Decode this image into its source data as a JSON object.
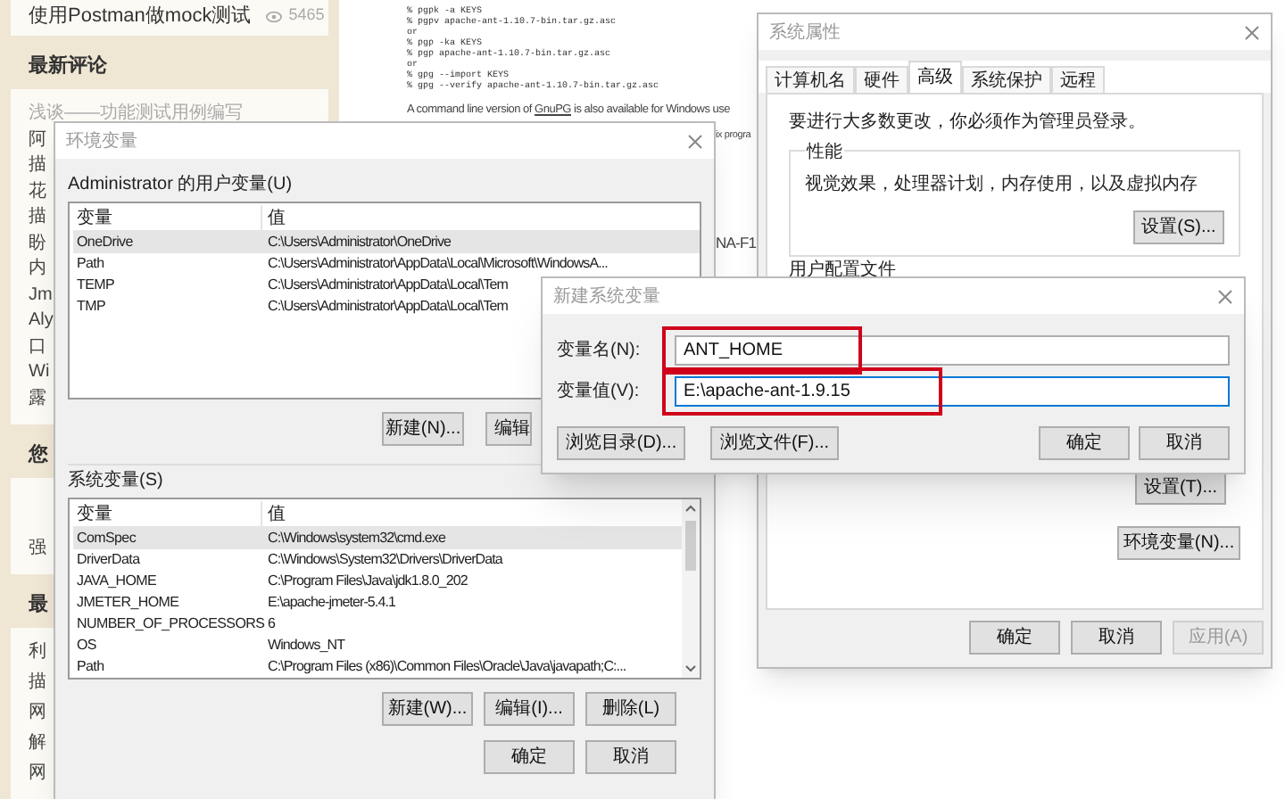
{
  "sidebar": {
    "popular_item": {
      "title": "使用Postman做mock测试",
      "views": "5465"
    },
    "sections": [
      {
        "heading": "最新评论",
        "lines": [
          "浅谈——功能测试用例编写",
          "阿",
          "描",
          "花",
          "描",
          "盼",
          "内",
          "Jm",
          "Aly",
          "口",
          "Wi",
          "露"
        ]
      },
      {
        "heading": "您",
        "lines": [
          "强"
        ]
      },
      {
        "heading": "最",
        "lines": [
          "利",
          "描",
          "网",
          "解",
          "网"
        ]
      }
    ]
  },
  "article": {
    "code_lines": [
      "% pgpk -a KEYS",
      "% pgpv apache-ant-1.10.7-bin.tar.gz.asc",
      "or",
      "% pgp -ka KEYS",
      "% pgp apache-ant-1.10.7-bin.tar.gz.asc",
      "or",
      "% gpg --import KEYS",
      "% gpg --verify apache-ant-1.10.7-bin.tar.gz.asc"
    ],
    "paragraph": {
      "before": "A command line version of ",
      "link": "GnuPG",
      "after": " is also available for Windows use"
    },
    "fragments": [
      "ix progra",
      "NA-F1"
    ]
  },
  "env_window": {
    "title": "环境变量",
    "user_section": {
      "label": "Administrator 的用户变量(U)",
      "columns": [
        "变量",
        "值"
      ],
      "rows": [
        {
          "name": "OneDrive",
          "value": "C:\\Users\\Administrator\\OneDrive",
          "selected": true
        },
        {
          "name": "Path",
          "value": "C:\\Users\\Administrator\\AppData\\Local\\Microsoft\\WindowsA...",
          "selected": false
        },
        {
          "name": "TEMP",
          "value": "C:\\Users\\Administrator\\AppData\\Local\\Tem",
          "selected": false
        },
        {
          "name": "TMP",
          "value": "C:\\Users\\Administrator\\AppData\\Local\\Tem",
          "selected": false
        }
      ],
      "buttons": [
        "新建(N)...",
        "编辑"
      ]
    },
    "system_section": {
      "label": "系统变量(S)",
      "columns": [
        "变量",
        "值"
      ],
      "rows": [
        {
          "name": "ComSpec",
          "value": "C:\\Windows\\system32\\cmd.exe",
          "selected": true
        },
        {
          "name": "DriverData",
          "value": "C:\\Windows\\System32\\Drivers\\DriverData",
          "selected": false
        },
        {
          "name": "JAVA_HOME",
          "value": "C:\\Program Files\\Java\\jdk1.8.0_202",
          "selected": false
        },
        {
          "name": "JMETER_HOME",
          "value": "E:\\apache-jmeter-5.4.1",
          "selected": false
        },
        {
          "name": "NUMBER_OF_PROCESSORS",
          "value": "6",
          "selected": false
        },
        {
          "name": "OS",
          "value": "Windows_NT",
          "selected": false
        },
        {
          "name": "Path",
          "value": "C:\\Program Files (x86)\\Common Files\\Oracle\\Java\\javapath;C:...",
          "selected": false
        }
      ],
      "buttons": [
        "新建(W)...",
        "编辑(I)...",
        "删除(L)"
      ]
    },
    "buttons": [
      "确定",
      "取消"
    ]
  },
  "system_properties": {
    "title": "系统属性",
    "tabs": [
      {
        "label": "计算机名",
        "selected": false
      },
      {
        "label": "硬件",
        "selected": false
      },
      {
        "label": "高级",
        "selected": true
      },
      {
        "label": "系统保护",
        "selected": false
      },
      {
        "label": "远程",
        "selected": false
      }
    ],
    "notice": "要进行大多数更改，你必须作为管理员登录。",
    "performance": {
      "label": "性能",
      "description": "视觉效果，处理器计划，内存使用，以及虚拟内存",
      "button": "设置(S)..."
    },
    "user_profiles": {
      "label": "用户配置文件",
      "button": "设置(T)..."
    },
    "env_button": "环境变量(N)...",
    "buttons": [
      {
        "label": "确定",
        "disabled": false
      },
      {
        "label": "取消",
        "disabled": false
      },
      {
        "label": "应用(A)",
        "disabled": true
      }
    ]
  },
  "new_variable_dialog": {
    "title": "新建系统变量",
    "fields": [
      {
        "label": "变量名(N):",
        "value": "ANT_HOME",
        "focused": false,
        "highlighted": true
      },
      {
        "label": "变量值(V):",
        "value": "E:\\apache-ant-1.9.15",
        "focused": true,
        "highlighted": true
      }
    ],
    "buttons": [
      "浏览目录(D)...",
      "浏览文件(F)...",
      "确定",
      "取消"
    ]
  }
}
